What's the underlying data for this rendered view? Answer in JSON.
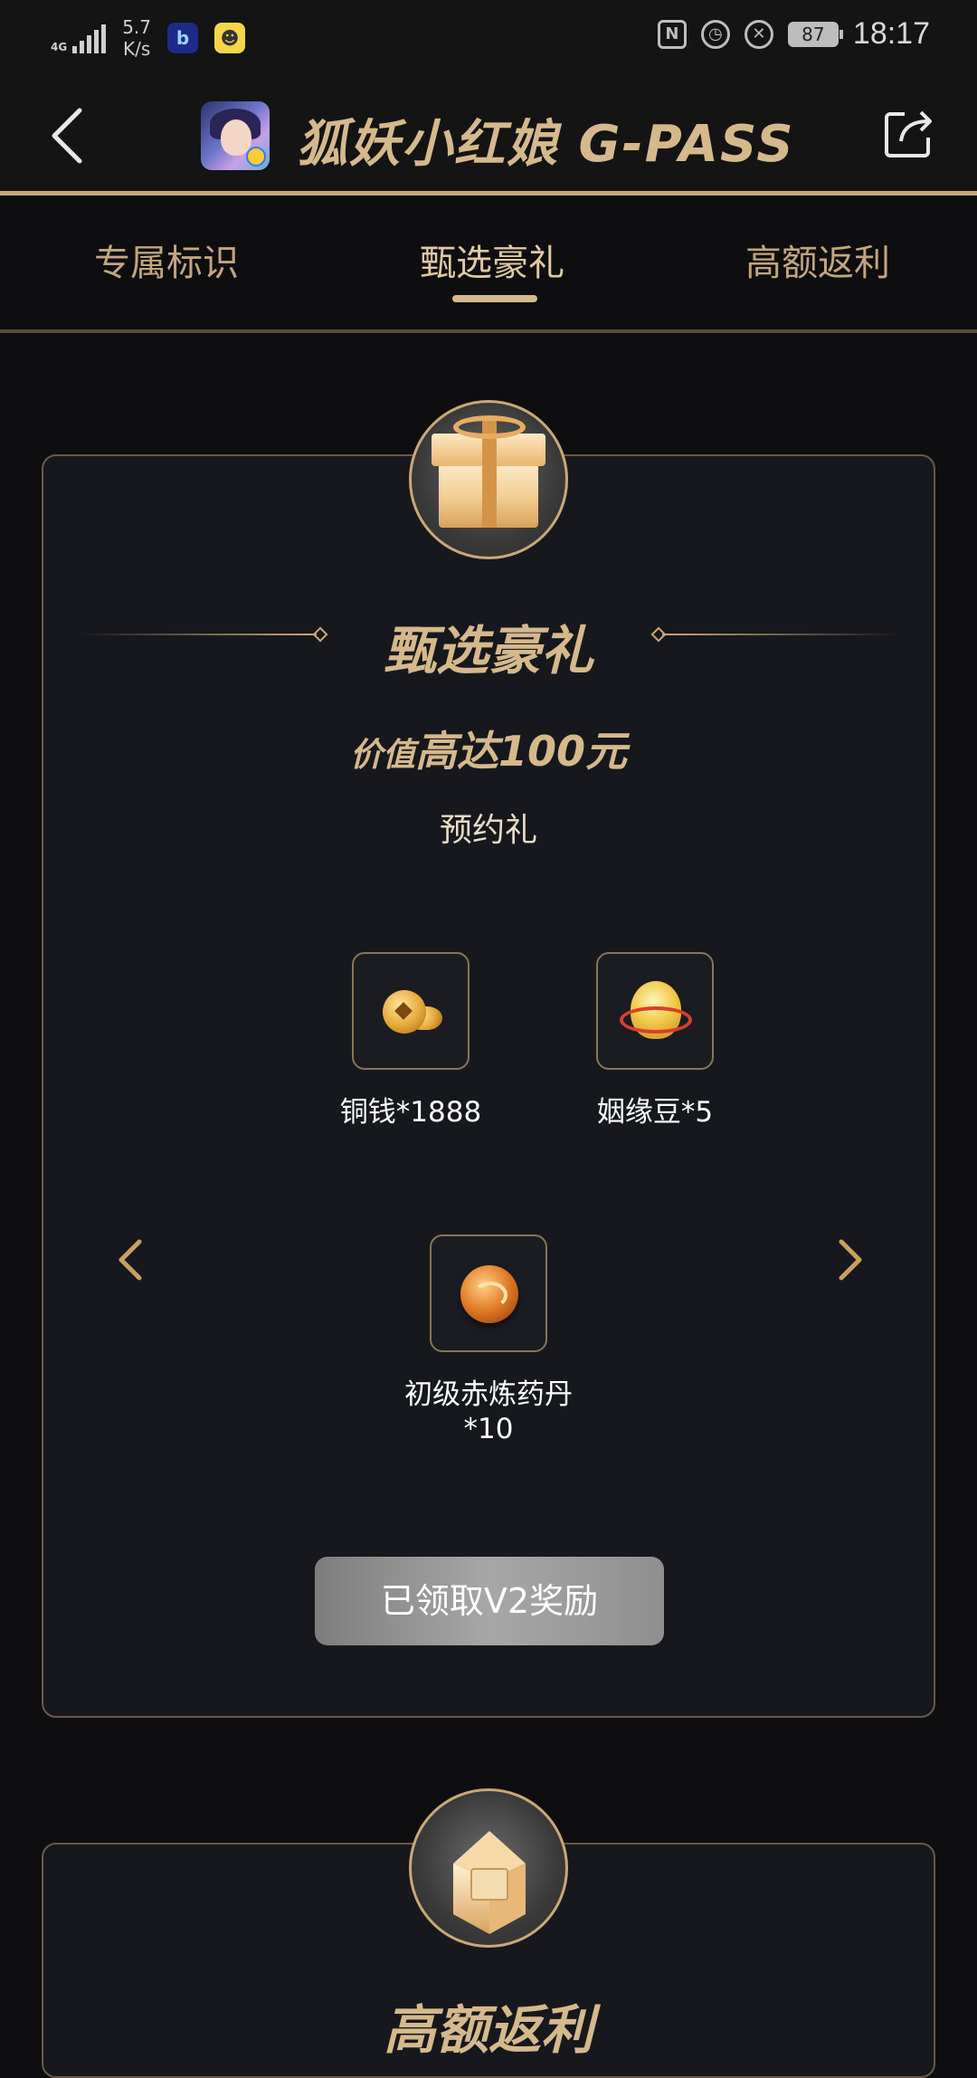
{
  "status_bar": {
    "network": "4G",
    "speed_value": "5.7",
    "speed_unit": "K/s",
    "battery": "87",
    "time": "18:17"
  },
  "header": {
    "title": "狐妖小红娘 G-PASS"
  },
  "tabs": [
    {
      "label": "专属标识",
      "active": false
    },
    {
      "label": "甄选豪礼",
      "active": true
    },
    {
      "label": "高额返利",
      "active": false
    }
  ],
  "gift_section": {
    "title": "甄选豪礼",
    "value_prefix": "价值",
    "value_main": "高达100元",
    "subtitle": "预约礼",
    "items": [
      {
        "label": "铜钱*1888",
        "icon": "copper-coin-icon"
      },
      {
        "label": "姻缘豆*5",
        "icon": "fate-bean-icon"
      },
      {
        "label_line1": "初级赤炼药丹",
        "label_line2": "*10",
        "icon": "red-pill-icon"
      }
    ],
    "claim_button": "已领取V2奖励"
  },
  "rebate_section": {
    "title": "高额返利"
  },
  "colors": {
    "gold": "#d5b98c",
    "background": "#0e0e10",
    "card": "#17181d",
    "button_gray": "#9a9a9a"
  }
}
